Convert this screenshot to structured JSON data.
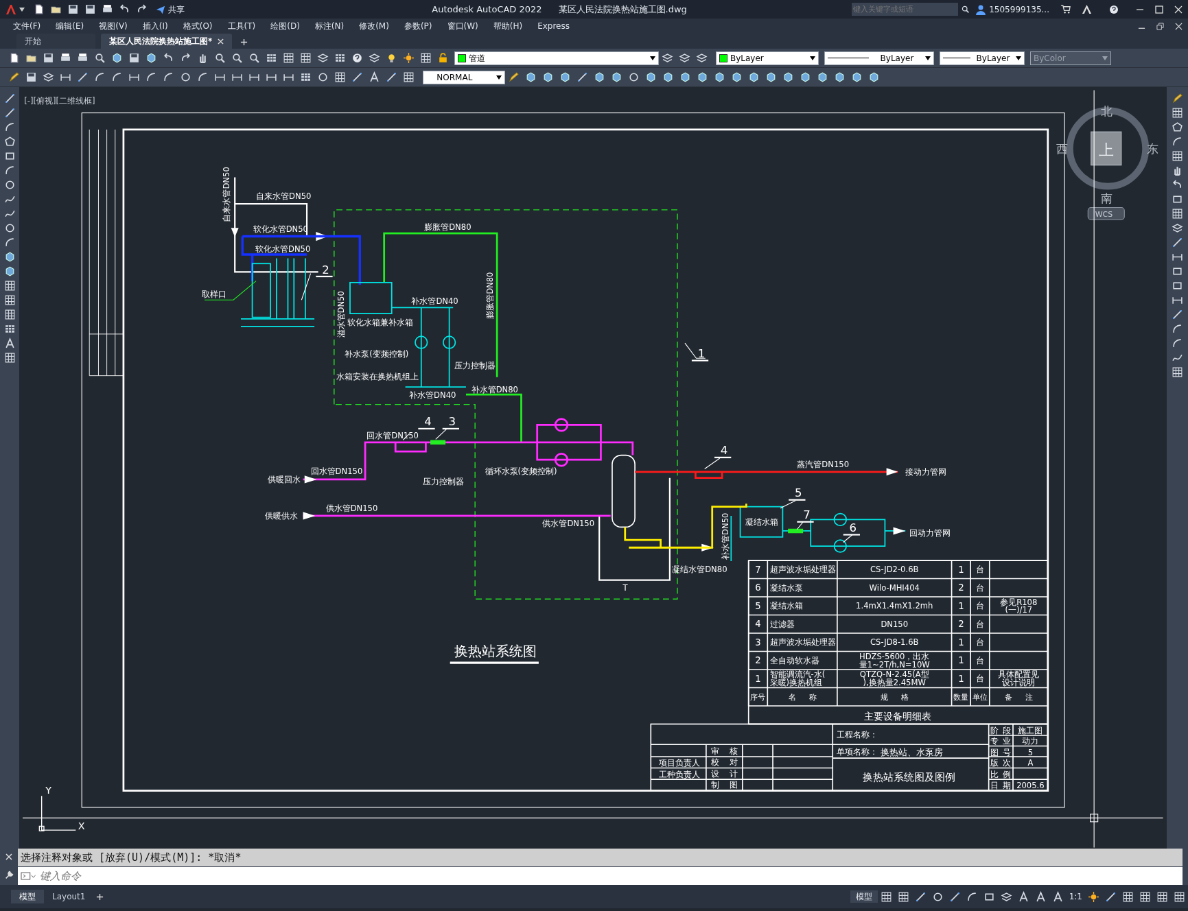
{
  "title_bar": {
    "share": "共享",
    "app_title": "Autodesk AutoCAD 2022",
    "file_name": "某区人民法院换热站施工图.dwg",
    "search": {
      "placeholder": "键入关键字或短语"
    },
    "user": "1505999135..."
  },
  "menu": [
    "文件(F)",
    "编辑(E)",
    "视图(V)",
    "插入(I)",
    "格式(O)",
    "工具(T)",
    "绘图(D)",
    "标注(N)",
    "修改(M)",
    "参数(P)",
    "窗口(W)",
    "帮助(H)",
    "Express"
  ],
  "file_tabs": [
    {
      "label": "开始",
      "selected": false
    },
    {
      "label": "某区人民法院换热站施工图*",
      "selected": true
    }
  ],
  "toolbar": {
    "layer": {
      "name": "管道",
      "color": "#00ff00"
    },
    "color": {
      "value": "ByLayer",
      "color": "#00ff00"
    },
    "linetype": "ByLayer",
    "lineweight": "ByLayer",
    "plot_style": {
      "value": "ByColor",
      "disabled": true
    },
    "text_style": "NORMAL"
  },
  "viewport_label": "[-][俯视][二维线框]",
  "view_cube": {
    "north": "北",
    "west": "西",
    "east": "东",
    "south": "南",
    "face": "上",
    "wcs": "WCS"
  },
  "ucs_icon": {
    "y": "Y",
    "x": "X"
  },
  "drawing": {
    "title": "换热站系统图",
    "item_numbers": [
      "2",
      "1",
      "4",
      "3",
      "4",
      "5",
      "7",
      "6"
    ],
    "pipe_labels": [
      "自来水管DN50",
      "自来水管DN50",
      "软化水管DN50",
      "软化水管DN50",
      "取样口",
      "膨胀管DN80",
      "软化水箱兼补水箱",
      "补水管DN40",
      "溢水管DN50",
      "膨胀管DN80",
      "补水泵(变频控制)",
      "水箱安装在换热机组上",
      "压力控制器",
      "补水管DN40",
      "补水管DN80",
      "回水管DN150",
      "回水管DN150",
      "供暖回水",
      "循环水泵(变频控制)",
      "压力控制器",
      "供水管DN150",
      "供暖供水",
      "供水管DN150",
      "蒸汽管DN150",
      "接动力管网",
      "凝结水管DN80",
      "补水管DN50",
      "凝结水箱",
      "回动力管网",
      "T"
    ]
  },
  "equipment_table": {
    "title": "主要设备明细表",
    "header": [
      "序号",
      "名 称",
      "规 格",
      "数量",
      "单位",
      "备 注"
    ],
    "rows": [
      {
        "no": "7",
        "name": "超声波水垢处理器",
        "spec": "CS-JD2-0.6B",
        "qty": "1",
        "unit": "台"
      },
      {
        "no": "6",
        "name": "凝结水泵",
        "spec": "Wilo-MHI404",
        "qty": "2",
        "unit": "台"
      },
      {
        "no": "5",
        "name": "凝结水箱",
        "spec": "1.4mX1.4mX1.2mh",
        "qty": "1",
        "unit": "台",
        "remark": "参见R108(一)/17"
      },
      {
        "no": "4",
        "name": "过滤器",
        "spec": "DN150",
        "qty": "2",
        "unit": "台"
      },
      {
        "no": "3",
        "name": "超声波水垢处理器",
        "spec": "CS-JD8-1.6B",
        "qty": "1",
        "unit": "台"
      },
      {
        "no": "2",
        "name": "全自动软水器",
        "spec": "HDZS-5600，出水量1~2T/h,N=10W",
        "qty": "1",
        "unit": "台"
      },
      {
        "no": "1",
        "name": "智能调流汽-水(采暖)换热机组",
        "spec": "QTZQ-N-2.45(A型),换热量2.45MW",
        "qty": "1",
        "unit": "台",
        "remark": "具体配置见设计说明"
      }
    ]
  },
  "title_block": {
    "project_label": "工程名称：",
    "item_label": "单项名称：",
    "item_name": "换热站、水泵房",
    "sheet_title": "换热站系统图及图例",
    "signatures": [
      "审 核",
      "校 对",
      "设 计",
      "制 图"
    ],
    "leads": [
      "项目负责人",
      "工种负责人"
    ],
    "info": [
      {
        "label": "阶 段",
        "value": "施工图"
      },
      {
        "label": "专 业",
        "value": "动力"
      },
      {
        "label": "图 号",
        "value": "5"
      },
      {
        "label": "版 次",
        "value": "A"
      },
      {
        "label": "比 例"
      },
      {
        "label": "日 期",
        "value": "2005.6"
      }
    ]
  },
  "command": {
    "history": "选择注释对象或 [放弃(U)/模式(M)]: *取消*",
    "placeholder": "键入命令"
  },
  "layout_tabs": [
    {
      "label": "模型",
      "selected": true
    },
    {
      "label": "Layout1",
      "selected": false
    }
  ],
  "status_bar": {
    "space": "模型",
    "scale": "1:1"
  }
}
